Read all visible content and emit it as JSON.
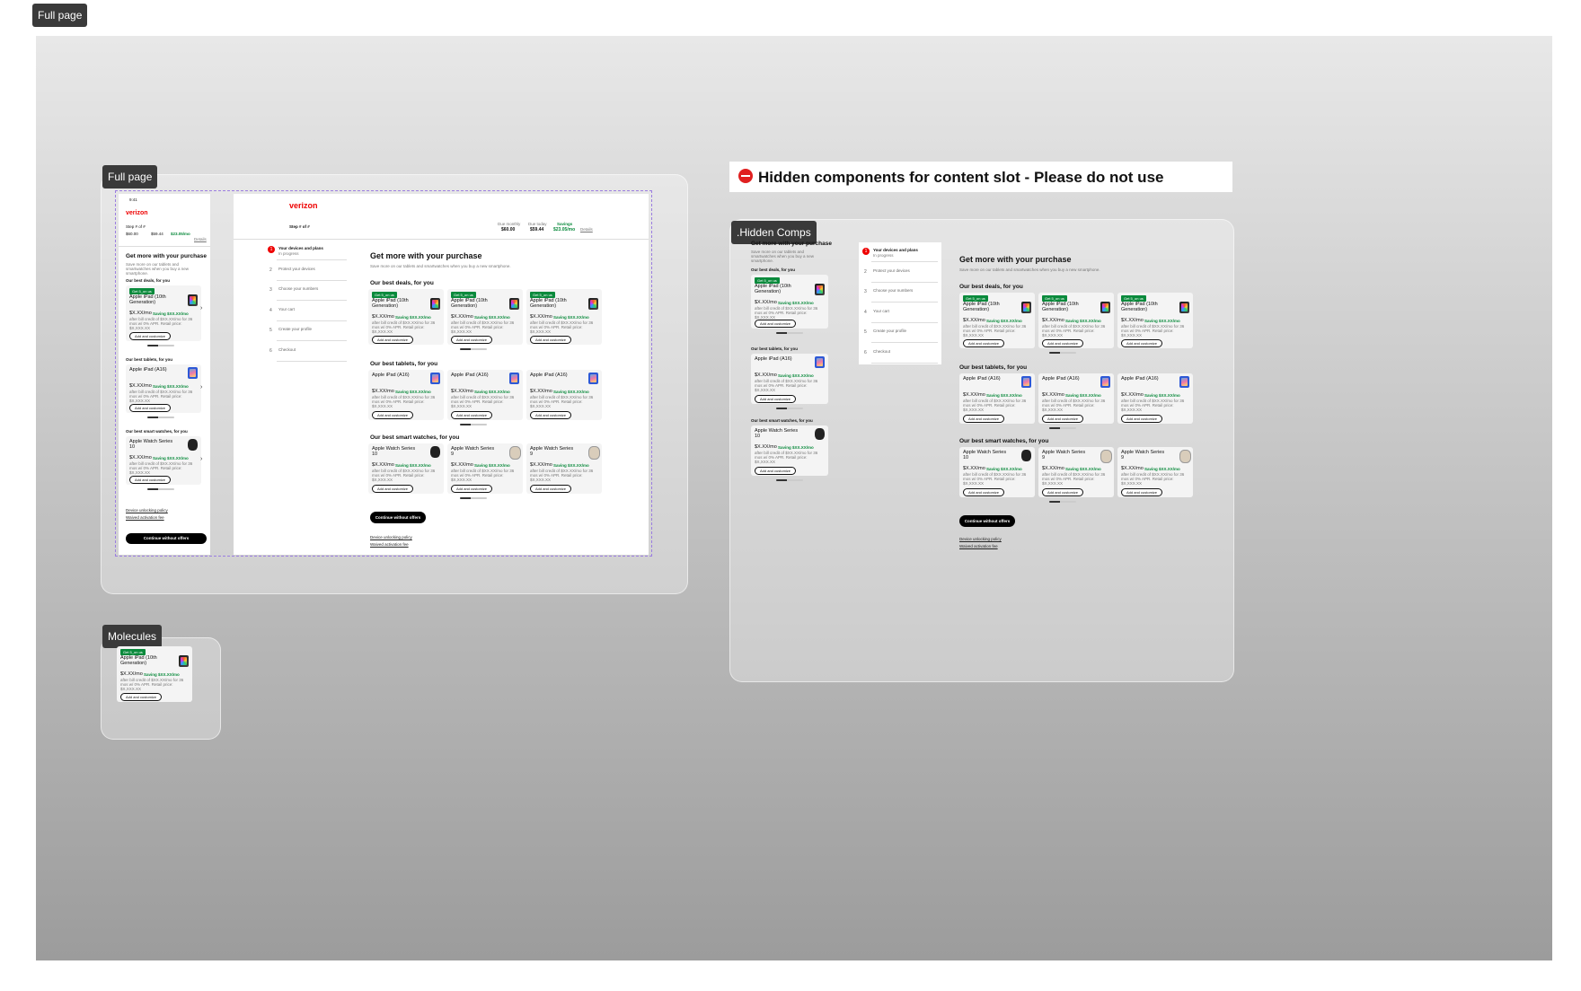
{
  "canvas_tag": "Full page",
  "sections": {
    "full_page": "Full page",
    "molecules": "Molecules",
    "hidden": ".Hidden Comps"
  },
  "warning": {
    "icon": "no-entry-icon",
    "title": "Hidden components for content slot - Please do not use"
  },
  "brand": "verizon",
  "mobile_time": "9:41",
  "step": "Step # of #",
  "totals": {
    "due_monthly_label": "Due monthly",
    "due_monthly": "$60.00",
    "due_today_label": "Due today",
    "due_today": "$59.44",
    "savings_label": "Savings",
    "savings": "$23.05/mo",
    "details": "Details"
  },
  "stepper": [
    {
      "n": "1",
      "label": "Your devices and plans",
      "sub": "In progress"
    },
    {
      "n": "2",
      "label": "Protect your devices"
    },
    {
      "n": "3",
      "label": "Choose your numbers"
    },
    {
      "n": "4",
      "label": "Your cart"
    },
    {
      "n": "5",
      "label": "Create your profile"
    },
    {
      "n": "6",
      "label": "Checkout"
    }
  ],
  "page_title": "Get more with your purchase",
  "page_sub": "Save more on our tablets and smartwatches when you buy a new smartphone.",
  "groups": [
    {
      "title": "Our best deals, for you",
      "device": "ipad",
      "badge": "Get 5_on us",
      "name": "Apple iPad (10th Generation)"
    },
    {
      "title": "Our best tablets, for you",
      "device": "ipada",
      "badge": "",
      "name": "Apple iPad (A16)"
    },
    {
      "title": "Our best smart watches, for you",
      "device": "watch",
      "badge": "",
      "name": "Apple Watch Series 10"
    }
  ],
  "watch9": "Apple Watch Series 9",
  "price": "$X.XX/mo",
  "saving": "Saving $XX.XX/mo",
  "fine": "after bill credit of $XX.XX/mo for 36 mos w/ 0% APR. Retail price: $X,XXX.XX",
  "add_btn": "Add and customize",
  "continue_btn": "Continue without offers",
  "links": [
    "Device unlocking policy",
    "Waived activation fee"
  ]
}
